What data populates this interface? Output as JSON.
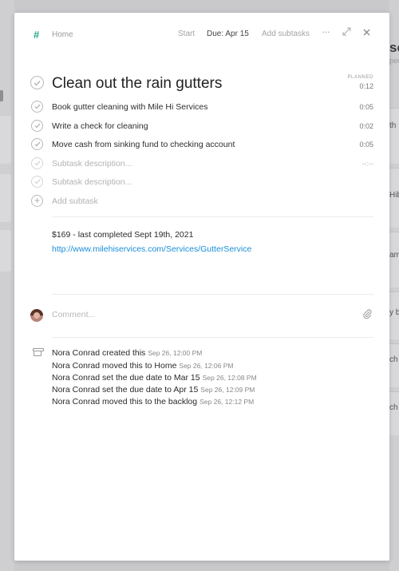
{
  "header": {
    "context_icon": "hash-icon",
    "context": "Home",
    "start_label": "Start",
    "due_label": "Due: Apr 15",
    "add_subtasks_label": "Add subtasks"
  },
  "task": {
    "title": "Clean out the rain gutters",
    "planned_label": "PLANNED",
    "planned_time": "0:12"
  },
  "subtasks": [
    {
      "text": "Book gutter cleaning with Mile Hi Services",
      "time": "0:05"
    },
    {
      "text": "Write a check for cleaning",
      "time": "0:02"
    },
    {
      "text": "Move cash from sinking fund to checking account",
      "time": "0:05"
    }
  ],
  "subtask_placeholders": [
    {
      "placeholder": "Subtask description...",
      "time": "--:--"
    },
    {
      "placeholder": "Subtask description..."
    }
  ],
  "add_subtask_label": "Add subtask",
  "notes": {
    "line1": "$169 - last completed Sept 19th, 2021",
    "link": "http://www.milehiservices.com/Services/GutterService"
  },
  "comment": {
    "placeholder": "Comment..."
  },
  "activity": [
    {
      "text": "Nora Conrad created this",
      "time": "Sep 26, 12:00 PM"
    },
    {
      "text": "Nora Conrad moved this to Home",
      "time": "Sep 26, 12:06 PM"
    },
    {
      "text": "Nora Conrad set the due date to Mar 15",
      "time": "Sep 26, 12:08 PM"
    },
    {
      "text": "Nora Conrad set the due date to Apr 15",
      "time": "Sep 26, 12:09 PM"
    },
    {
      "text": "Nora Conrad moved this to the backlog",
      "time": "Sep 26, 12:12 PM"
    }
  ],
  "background": {
    "right_heading": "sc",
    "right_sub": "pen",
    "right_snippets": [
      "th",
      "Hib",
      "am",
      "y b",
      "ch",
      "ch"
    ]
  },
  "colors": {
    "accent": "#27a88c",
    "link": "#1a8fd8"
  }
}
